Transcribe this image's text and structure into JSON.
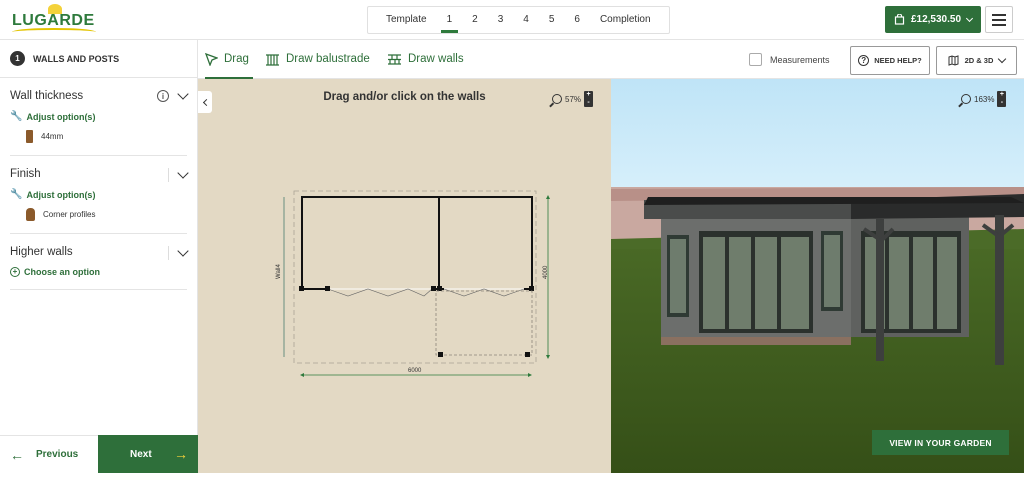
{
  "header": {
    "logo_text": "LUGARDE",
    "steps": [
      "Template",
      "1",
      "2",
      "3",
      "4",
      "5",
      "6",
      "Completion"
    ],
    "active_step": "1",
    "price": "£12,530.50"
  },
  "left_panel": {
    "step_number": "1",
    "step_title": "WALLS AND POSTS",
    "sections": {
      "wall_thickness": {
        "title": "Wall thickness",
        "adjust": "Adjust option(s)",
        "option": "44mm"
      },
      "finish": {
        "title": "Finish",
        "adjust": "Adjust option(s)",
        "option": "Corner profiles"
      },
      "higher_walls": {
        "title": "Higher walls",
        "choose": "Choose an option"
      }
    },
    "previous": "Previous",
    "next": "Next"
  },
  "toolbar": {
    "drag": "Drag",
    "draw_balustrade": "Draw balustrade",
    "draw_walls": "Draw walls",
    "measurements": "Measurements",
    "help": "NEED HELP?",
    "view_mode": "2D & 3D"
  },
  "panel_2d": {
    "title": "Drag and/or click on the walls",
    "zoom": "57%",
    "dim_width": "6000",
    "dim_depth": "4000",
    "wall_label": "Wall4"
  },
  "panel_3d": {
    "zoom": "163%",
    "garden_button": "VIEW IN YOUR GARDEN"
  },
  "colors": {
    "brand_green": "#2e6f3a",
    "accent_yellow": "#f4d23a",
    "plan_bg": "#e3d9c4",
    "sky": "#c9e9f9",
    "grass": "#3f5c1f"
  }
}
